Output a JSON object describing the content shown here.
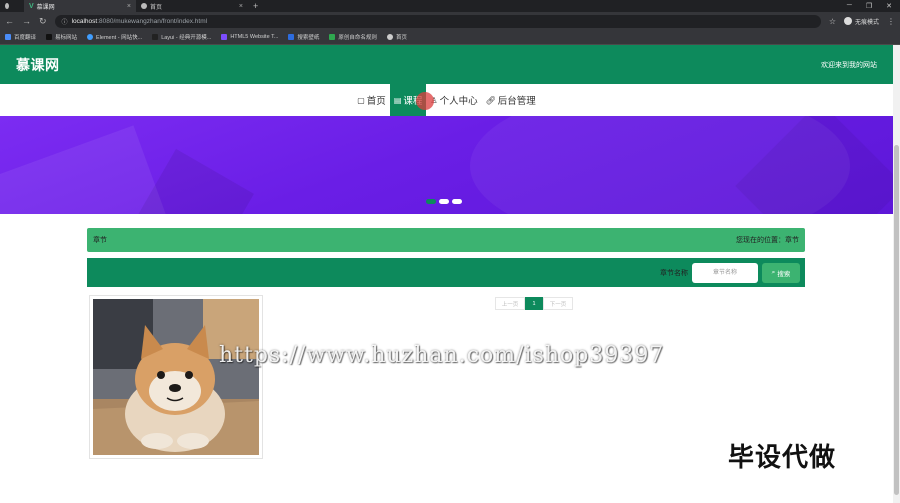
{
  "browser": {
    "tabs": [
      {
        "title": "",
        "active": false,
        "icon": "globe-icon"
      },
      {
        "title": "慕课网",
        "active": true,
        "icon": "vue-icon"
      },
      {
        "title": "首页",
        "active": false,
        "icon": "globe-icon"
      }
    ],
    "new_tab_symbol": "+",
    "url_host": "localhost",
    "url_path": ":8080/mukewangzhan/front/index.html",
    "profile_label": "无痕模式",
    "bookmarks": [
      {
        "label": "百度翻译",
        "color": "#4a8cf7"
      },
      {
        "label": "易标网站",
        "color": "#111111"
      },
      {
        "label": "Element - 网站快...",
        "color": "#409eff"
      },
      {
        "label": "Layui - 经典开源模...",
        "color": "#222222"
      },
      {
        "label": "HTML5 Website T...",
        "color": "#7c4dff"
      },
      {
        "label": "搜索壁纸",
        "color": "#2d6cdf"
      },
      {
        "label": "原创自命名规则",
        "color": "#2fa84f"
      },
      {
        "label": "首页",
        "color": "#cccccc"
      }
    ]
  },
  "site": {
    "logo": "慕课网",
    "welcome": "欢迎来到我的网站",
    "nav": [
      {
        "label": "首页",
        "icon": "home-icon",
        "active": false
      },
      {
        "label": "课程",
        "icon": "list-icon",
        "active": true
      },
      {
        "label": "个人中心",
        "icon": "user-icon",
        "active": false
      },
      {
        "label": "后台管理",
        "icon": "link-icon",
        "active": false
      }
    ],
    "banner_dots": [
      true,
      false,
      false
    ],
    "chapter": {
      "title": "章节",
      "location": "您现在的位置：章节"
    },
    "search": {
      "label": "章节名称",
      "placeholder": "章节名称",
      "button": "搜索"
    },
    "pagination": {
      "prev": "上一页",
      "current": "1",
      "next": "下一页"
    }
  },
  "overlay": {
    "watermark": "https://www.huzhan.com/ishop39397",
    "stamp": "毕设代做"
  },
  "colors": {
    "primary": "#0d8a5c",
    "accent_green": "#3cb371",
    "banner_purple": "#6a1ee6"
  }
}
